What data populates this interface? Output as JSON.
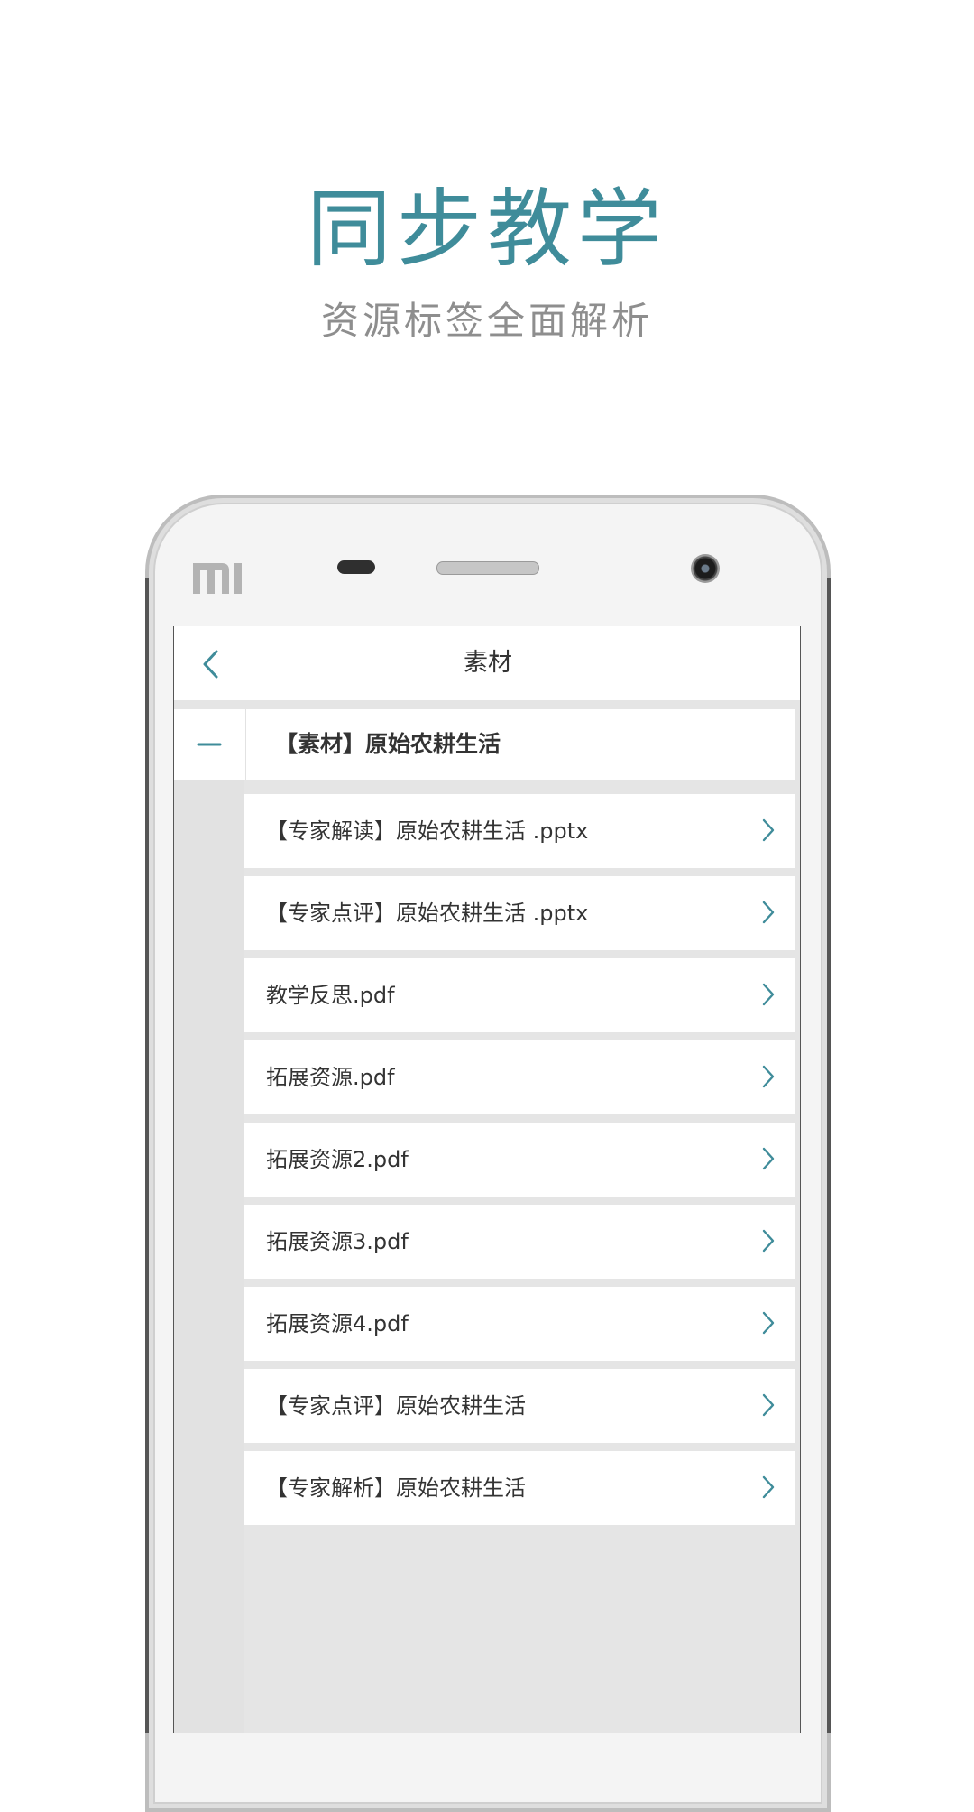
{
  "hero": {
    "title": "同步教学",
    "subtitle": "资源标签全面解析"
  },
  "colors": {
    "accent": "#3f8c9a",
    "subtitle": "#8e8e8e",
    "list_background": "#e5e5e5",
    "row_background": "#ffffff"
  },
  "app": {
    "nav": {
      "back_icon": "chevron-left-icon",
      "title": "素材"
    },
    "group": {
      "toggle_icon": "minus-icon",
      "label": "【素材】原始农耕生活"
    },
    "files": [
      {
        "name": "【专家解读】原始农耕生活 .pptx"
      },
      {
        "name": "【专家点评】原始农耕生活 .pptx"
      },
      {
        "name": "教学反思.pdf"
      },
      {
        "name": "拓展资源.pdf"
      },
      {
        "name": "拓展资源2.pdf"
      },
      {
        "name": "拓展资源3.pdf"
      },
      {
        "name": "拓展资源4.pdf"
      },
      {
        "name": "【专家点评】原始农耕生活"
      },
      {
        "name": "【专家解析】原始农耕生活"
      }
    ]
  }
}
